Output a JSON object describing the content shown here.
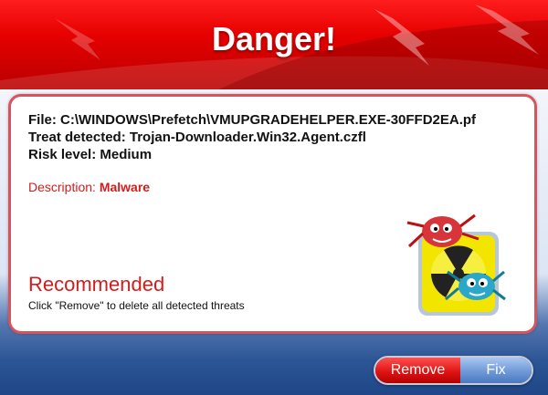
{
  "header": {
    "title": "Danger!"
  },
  "details": {
    "file": "File: C:\\WINDOWS\\Prefetch\\VMUPGRADEHELPER.EXE-30FFD2EA.pf",
    "treat": "Treat detected: Trojan-Downloader.Win32.Agent.czfl",
    "risk": "Risk level: Medium"
  },
  "description": {
    "label": "Description:",
    "value": "Malware"
  },
  "recommended": {
    "title": "Recommended",
    "text": "Click \"Remove\" to delete all detected threats"
  },
  "buttons": {
    "remove": "Remove",
    "fix": "Fix"
  },
  "colors": {
    "accent_red": "#d41c1c",
    "header_red": "#e60000",
    "fix_blue": "#6f98d6"
  },
  "icons": {
    "threat": "radioactive-bugs-icon"
  }
}
